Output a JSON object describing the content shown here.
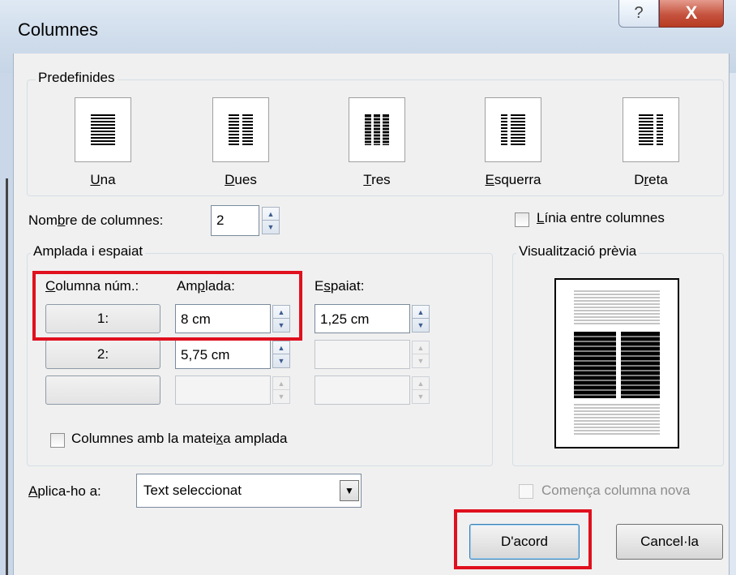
{
  "window": {
    "title": "Columnes",
    "help_glyph": "?",
    "close_glyph": "X"
  },
  "presets": {
    "group_label": "Predefinides",
    "items": [
      {
        "key": "U",
        "rest": "na"
      },
      {
        "key": "D",
        "rest": "ues"
      },
      {
        "key": "T",
        "rest": "res"
      },
      {
        "key": "E",
        "rest": "squerra"
      },
      {
        "pre": "D",
        "key": "r",
        "rest": "eta"
      }
    ]
  },
  "num_columns": {
    "label_pre": "Nom",
    "label_key": "b",
    "label_post": "re de columnes:",
    "value": "2"
  },
  "line_between": {
    "key": "L",
    "rest": "ínia entre columnes",
    "checked": false
  },
  "width_spacing": {
    "group_label": "Amplada i espaiat",
    "col_header_key": "C",
    "col_header_rest": "olumna núm.:",
    "width_header_pre": "Am",
    "width_header_key": "p",
    "width_header_rest": "lada:",
    "spacing_header_pre": "E",
    "spacing_header_key": "s",
    "spacing_header_rest": "paiat:",
    "rows": [
      {
        "col": "1:",
        "width": "8 cm",
        "spacing": "1,25 cm"
      },
      {
        "col": "2:",
        "width": "5,75 cm",
        "spacing": ""
      },
      {
        "col": "",
        "width": "",
        "spacing": ""
      }
    ],
    "equal_pre": "Columnes amb la matei",
    "equal_key": "x",
    "equal_post": "a amplada",
    "equal_checked": false
  },
  "preview": {
    "group_label": "Visualització prèvia"
  },
  "apply_to": {
    "label_key": "A",
    "label_rest": "plica-ho a:",
    "value": "Text seleccionat"
  },
  "new_column": {
    "label": "Comença columna nova",
    "enabled": false
  },
  "buttons": {
    "ok": "D'acord",
    "cancel": "Cancel·la"
  },
  "colors": {
    "highlight": "#e0101e",
    "close_button": "#c5533e"
  }
}
